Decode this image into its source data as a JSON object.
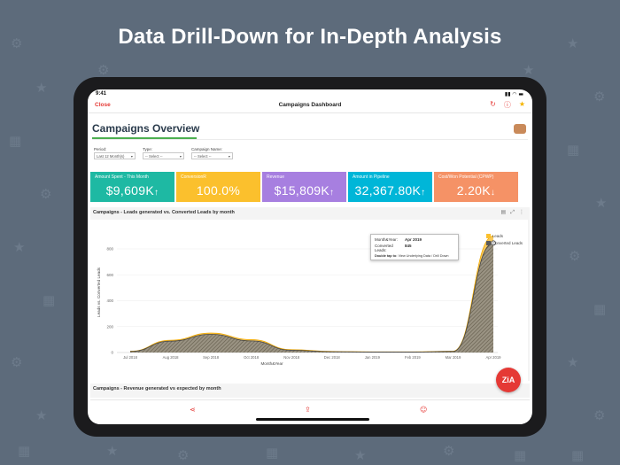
{
  "headline": "Data Drill-Down  for In-Depth Analysis",
  "status": {
    "time": "9:41"
  },
  "nav": {
    "close": "Close",
    "title": "Campaigns Dashboard"
  },
  "dashboard": {
    "title": "Campaigns Overview",
    "filters": [
      {
        "label": "Period:",
        "value": "Last 12 Month(s)"
      },
      {
        "label": "Type:",
        "value": "-- Select --"
      },
      {
        "label": "Campaign Name:",
        "value": "-- Select --"
      }
    ],
    "kpis": [
      {
        "label": "Amount Spent - This Month",
        "value": "$9,609K",
        "color": "#1eb9a3"
      },
      {
        "label": "ConversionR",
        "value": "100.0%",
        "color": "#fbc02d"
      },
      {
        "label": "Revenue",
        "value": "$15,809K",
        "color": "#a77fe0"
      },
      {
        "label": "Amount in Pipeline",
        "value": "32,367.80K",
        "color": "#00b6d8"
      },
      {
        "label": "Cost/Won Potential (CPWP)",
        "value": "2.20K",
        "color": "#f59266"
      }
    ],
    "chart1_title": "Campaigns - Leads generated vs. Converted Leads by month",
    "chart2_title": "Campaigns - Revenue generated vs expected by month"
  },
  "tooltip": {
    "k1": "Month&Year:",
    "v1": "Apr 2019",
    "k2": "Converted Leads:",
    "v2": "845",
    "hint_bold": "Double tap to:",
    "hint": " View Underlying Data / Drill Down"
  },
  "zia_label": "ZiA",
  "chart_data": {
    "type": "area",
    "title": "Campaigns - Leads generated vs. Converted Leads by month",
    "xlabel": "Month&Year",
    "ylabel": "Leads vs. Converted Leads",
    "categories": [
      "Jul 2018",
      "Aug 2018",
      "Sep 2018",
      "Oct 2018",
      "Nov 2018",
      "Dec 2018",
      "Jan 2019",
      "Feb 2019",
      "Mar 2019",
      "Apr 2019"
    ],
    "series": [
      {
        "name": "Leads",
        "color": "#fbc02d",
        "values": [
          10,
          95,
          150,
          100,
          22,
          8,
          5,
          5,
          10,
          900
        ]
      },
      {
        "name": "Converted Leads",
        "color": "#5a5a5a",
        "values": [
          8,
          88,
          140,
          90,
          18,
          6,
          4,
          4,
          8,
          845
        ]
      }
    ],
    "yticks": [
      0,
      200,
      400,
      600,
      800
    ],
    "ylim": [
      0,
      930
    ],
    "legend": "top-right"
  }
}
